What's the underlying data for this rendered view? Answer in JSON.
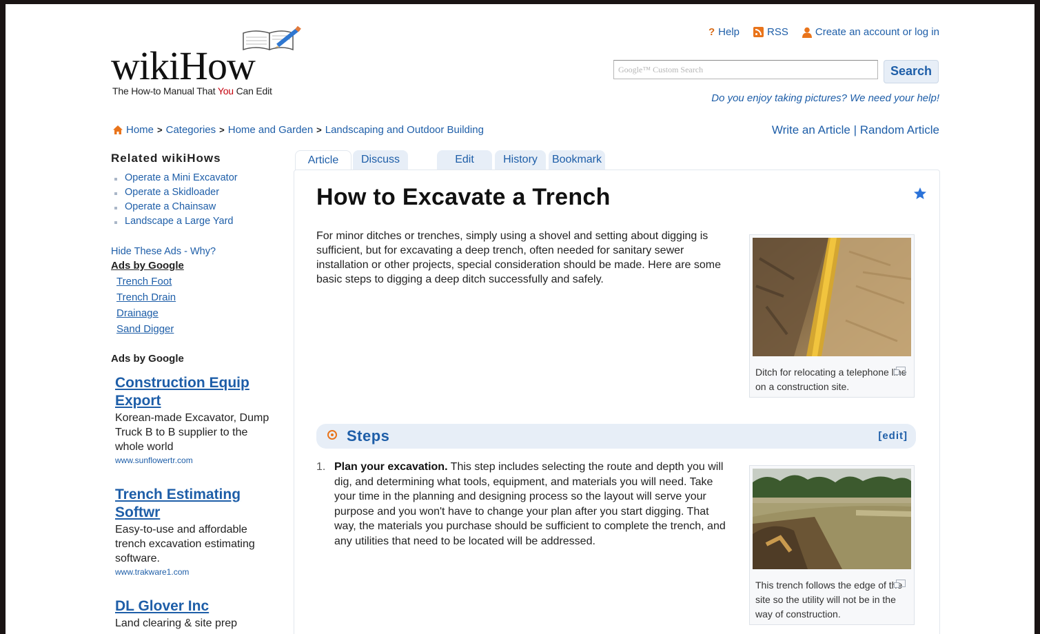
{
  "header": {
    "logo_text": "wikiHow",
    "tagline_pre": "The How-to Manual That ",
    "tagline_you": "You",
    "tagline_post": " Can Edit",
    "links": {
      "help_icon": "?",
      "help": "Help",
      "rss": "RSS",
      "account": "Create an account or log in"
    },
    "search": {
      "placeholder": "Google™ Custom Search",
      "button": "Search"
    },
    "promo": "Do you enjoy taking pictures? We need your help!"
  },
  "breadcrumb": {
    "items": [
      "Home",
      "Categories",
      "Home and Garden",
      "Landscaping and Outdoor Building"
    ],
    "separator": ">"
  },
  "right_links": {
    "write": "Write an Article",
    "divider": " | ",
    "random": "Random Article"
  },
  "sidebar": {
    "related_heading": "Related wikiHows",
    "related": [
      "Operate a Mini Excavator",
      "Operate a Skidloader",
      "Operate a Chainsaw",
      "Landscape a Large Yard"
    ],
    "hide_ads": "Hide These Ads - Why?",
    "ads_by_google_1": "Ads by Google",
    "ad_links": [
      "Trench Foot",
      "Trench Drain",
      "Drainage",
      "Sand Digger"
    ],
    "ads_by_google_2": "Ads by Google",
    "ads": [
      {
        "title": "Construction Equip Export",
        "desc": "Korean-made Excavator, Dump Truck B to B supplier to the whole world",
        "url": "www.sunflowertr.com"
      },
      {
        "title": "Trench Estimating Softwr",
        "desc": "Easy-to-use and affordable trench excavation estimating software.",
        "url": "www.trakware1.com"
      },
      {
        "title": "DL Glover Inc",
        "desc": "Land clearing & site prep",
        "url": ""
      }
    ]
  },
  "tabs": [
    "Article",
    "Discuss",
    "Edit",
    "History",
    "Bookmark"
  ],
  "article": {
    "title": "How to Excavate a Trench",
    "intro": "For minor ditches or trenches, simply using a shovel and setting about digging is sufficient, but for excavating a deep trench, often needed for sanitary sewer installation or other projects, special consideration should be made. Here are some basic steps to digging a deep ditch successfully and safely.",
    "figure1_caption": "Ditch for relocating a telephone line on a construction site.",
    "steps_heading": "Steps",
    "edit_label": "[edit]",
    "step1_num": "1.",
    "step1_bold": "Plan your excavation.",
    "step1_text": " This step includes selecting the route and depth you will dig, and determining what tools, equipment, and materials you will need. Take your time in the planning and designing process so the layout will serve your purpose and you won't have to change your plan after you start digging. That way, the materials you purchase should be sufficient to complete the trench, and any utilities that need to be located will be addressed.",
    "figure2_caption": "This trench follows the edge of the site so the utility will not be in the way of construction."
  },
  "icons": {
    "home": "home-icon",
    "star": "star-icon",
    "rss": "rss-icon",
    "account": "person-icon",
    "steps": "target-icon"
  },
  "colors": {
    "link": "#1e5ea8",
    "accent_orange": "#e9741b",
    "tab_bg": "#e7eef7",
    "you_red": "#c4000d"
  }
}
